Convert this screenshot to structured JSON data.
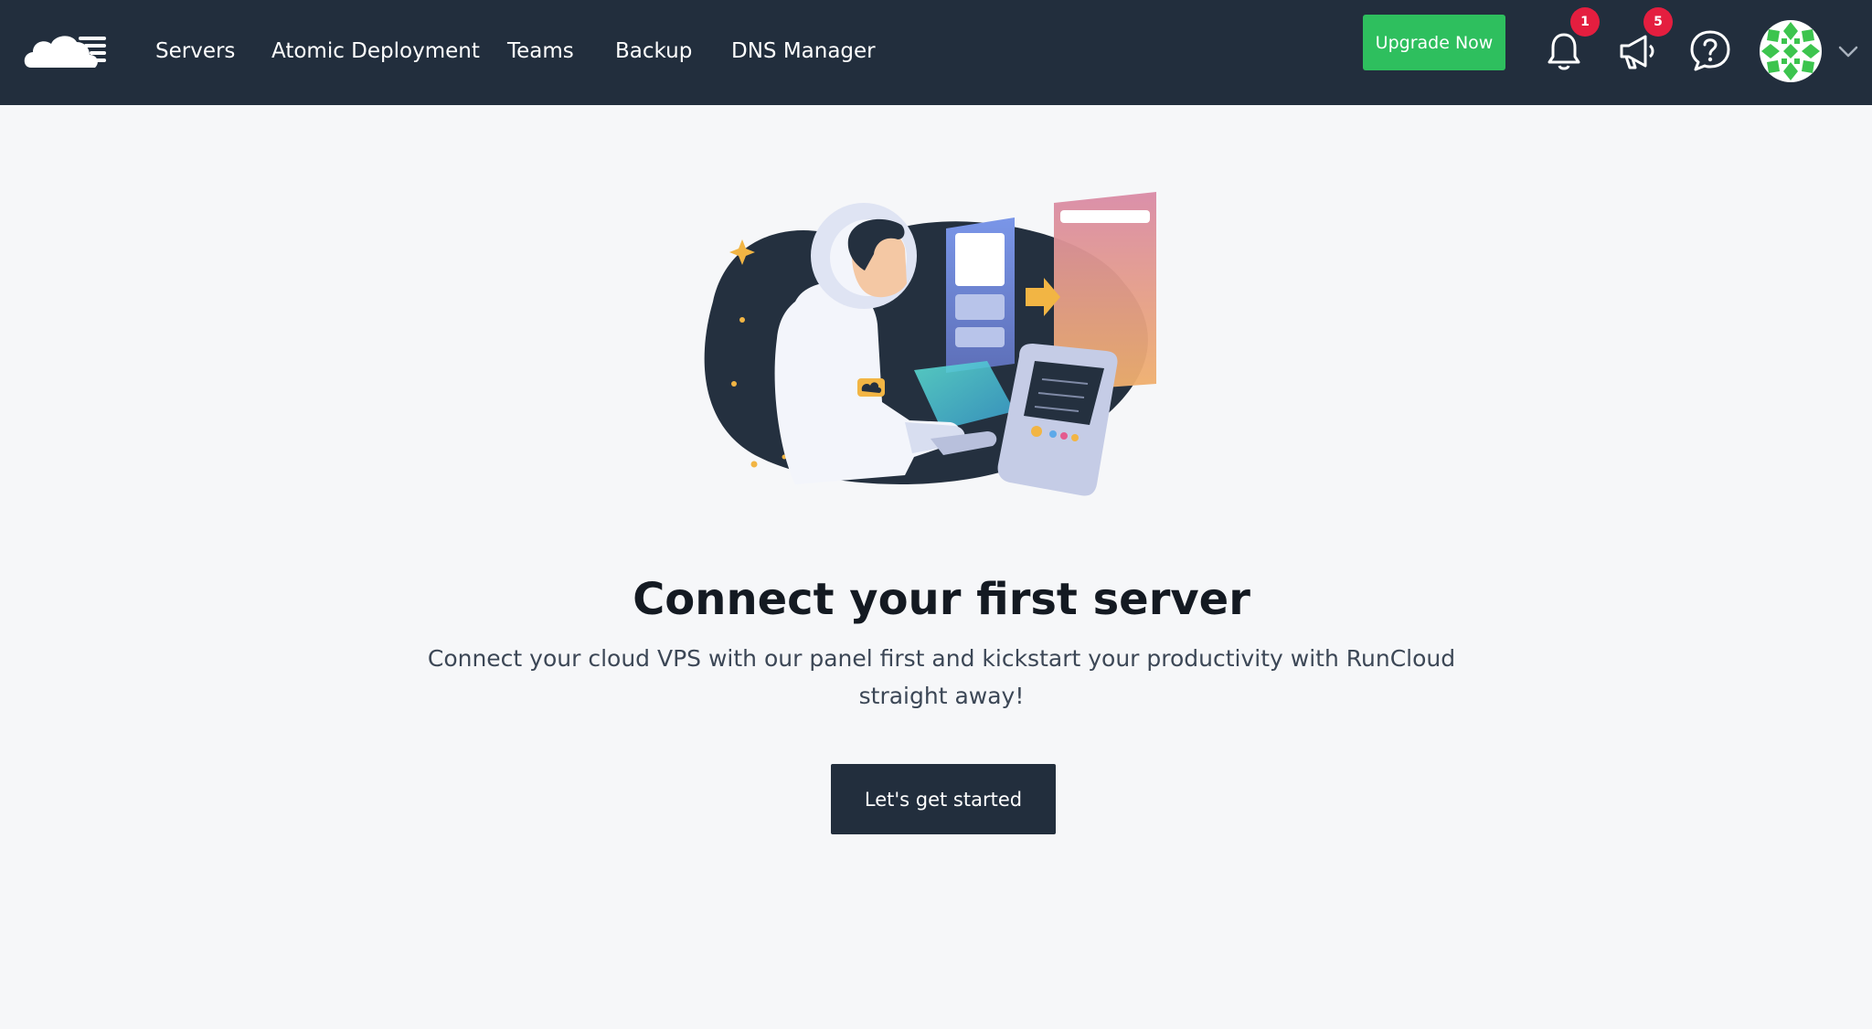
{
  "nav": {
    "items": [
      {
        "label": "Servers"
      },
      {
        "label": "Atomic Deployment"
      },
      {
        "label": "Teams"
      },
      {
        "label": "Backup"
      },
      {
        "label": "DNS Manager"
      }
    ],
    "upgrade_label": "Upgrade Now",
    "notifications_count": "1",
    "announcements_count": "5"
  },
  "empty_state": {
    "title": "Connect your first server",
    "description": "Connect your cloud VPS with our panel first and kickstart your productivity with RunCloud straight away!",
    "cta_label": "Let's get started"
  },
  "colors": {
    "header_bg": "#222e3d",
    "upgrade_green": "#2ebf5e",
    "badge_red": "#e41e3f",
    "page_bg": "#f6f7f9"
  },
  "icons": [
    "runcloud-logo-icon",
    "bell-icon",
    "megaphone-icon",
    "help-icon",
    "chevron-down-icon"
  ]
}
